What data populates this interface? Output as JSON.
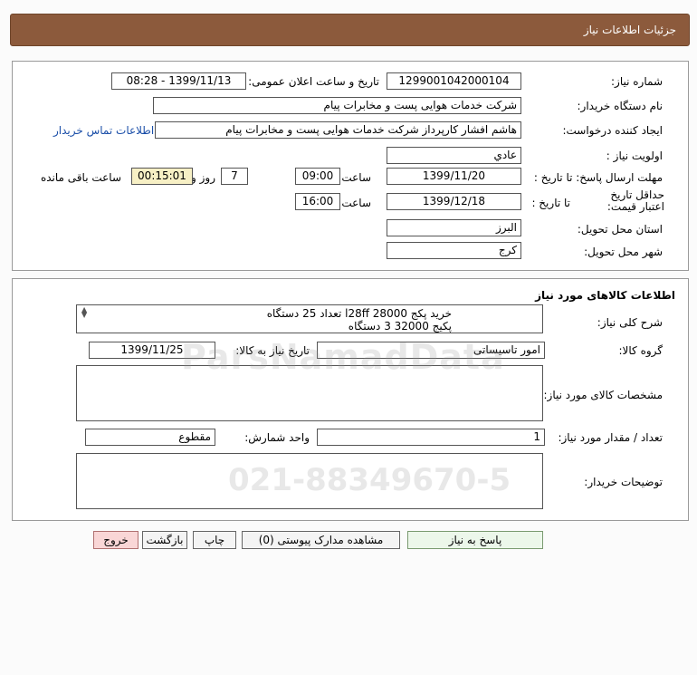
{
  "header": {
    "title": "جزئیات اطلاعات نیاز"
  },
  "need": {
    "need_number_label": "شماره نیاز:",
    "need_number": "1299001042000104",
    "announce_label": "تاریخ و ساعت اعلان عمومی:",
    "announce_value": "1399/11/13 - 08:28",
    "buyer_org_label": "نام دستگاه خریدار:",
    "buyer_org": "شرکت خدمات هوایی پست و مخابرات پیام",
    "creator_label": "ایجاد کننده درخواست:",
    "creator": "هاشم افشار کارپرداز شرکت خدمات هوایی پست و مخابرات پیام",
    "contact_link": "اطلاعات تماس خریدار",
    "priority_label": "اولویت نیاز :",
    "priority": "عادي",
    "send_deadline_label": "مهلت ارسال پاسخ: تا تاریخ :",
    "send_date": "1399/11/20",
    "time_label": "ساعت",
    "send_time": "09:00",
    "days": "7",
    "days_label": "روز و",
    "remaining": "00:15:01",
    "remaining_label": "ساعت باقی مانده",
    "validity_label": "حداقل تاریخ اعتبار قیمت:",
    "validity_to_label": "تا تاریخ :",
    "validity_date": "1399/12/18",
    "validity_time_label": "ساعت",
    "validity_time": "16:00",
    "province_label": "استان محل تحویل:",
    "province": "البرز",
    "city_label": "شهر محل تحویل:",
    "city": "کرج"
  },
  "goods": {
    "section_title": "اطلاعات کالاهای مورد نیاز",
    "desc_label": "شرح کلی نیاز:",
    "desc_line1": "خرید پکج l28ff 28000 تعداد 25 دستگاه",
    "desc_line2": "پکیج 32000 3 دستگاه",
    "group_label": "گروه کالا:",
    "group": "امور تاسیساتی",
    "need_date_label": "تاریخ نیاز به کالا:",
    "need_date": "1399/11/25",
    "specs_label": "مشخصات کالای مورد نیاز:",
    "qty_label": "تعداد / مقدار مورد نیاز:",
    "qty": "1",
    "unit_label": "واحد شمارش:",
    "unit": "مقطوع",
    "buyer_notes_label": "توضیحات خریدار:"
  },
  "buttons": {
    "reply": "پاسخ به نیاز",
    "attachments": "مشاهده مدارک پیوستی (0)",
    "print": "چاپ",
    "back": "بازگشت",
    "exit": "خروج"
  },
  "watermark": {
    "brand": "ParsNamadData",
    "phone": "021-88349670-5"
  },
  "colors": {
    "header_bg": "#8c5a3c",
    "link": "#1a4ea8",
    "remaining_bg": "#f7f0c5",
    "exit_bg": "#f9d6d6",
    "reply_bg": "#ecf7ea"
  }
}
